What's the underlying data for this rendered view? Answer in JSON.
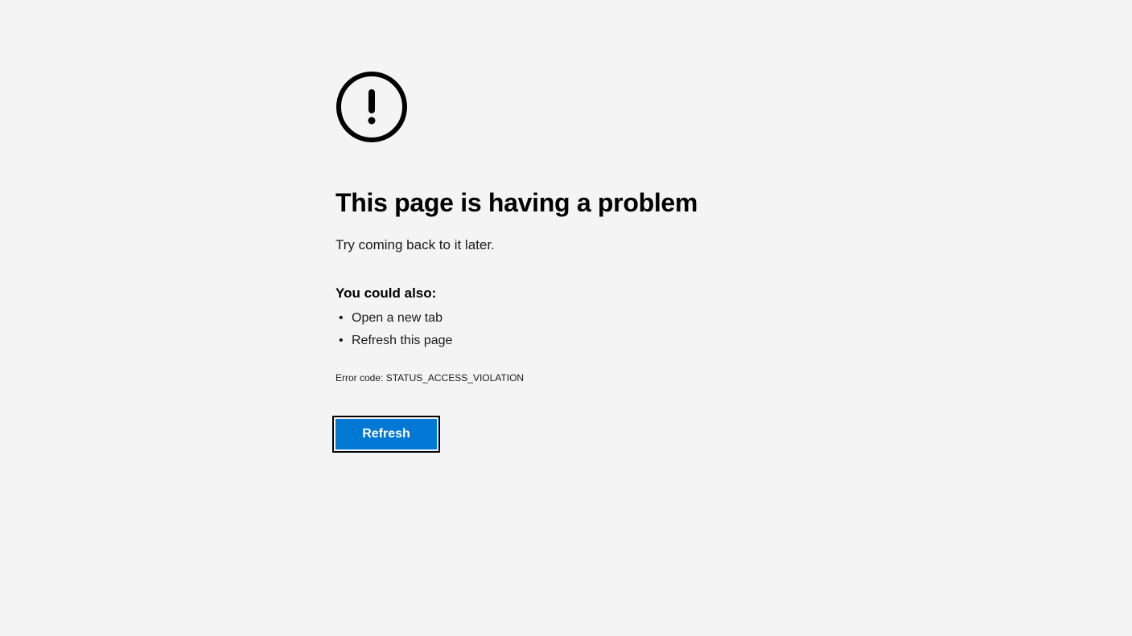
{
  "error": {
    "heading": "This page is having a problem",
    "subtext": "Try coming back to it later.",
    "suggestionHeading": "You could also:",
    "suggestions": [
      "Open a new tab",
      "Refresh this page"
    ],
    "errorCodeLabel": "Error code: STATUS_ACCESS_VIOLATION",
    "refreshButton": "Refresh"
  }
}
